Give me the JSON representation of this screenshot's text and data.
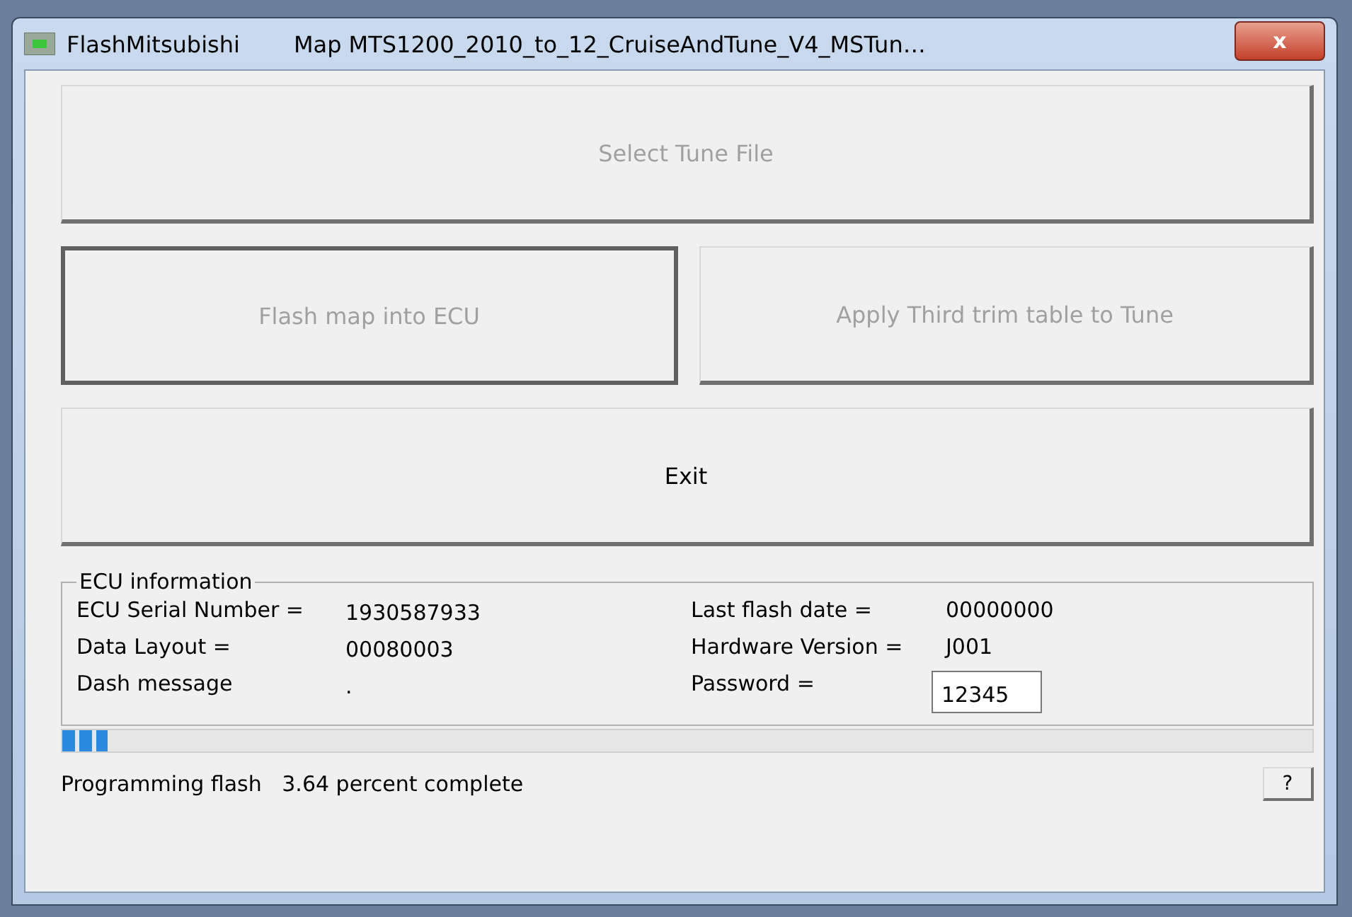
{
  "window": {
    "app_name": "FlashMitsubishi",
    "title": "Map MTS1200_2010_to_12_CruiseAndTune_V4_MSTun…",
    "close": "x"
  },
  "buttons": [
    {
      "label": "Select Tune File",
      "disabled": true,
      "focused": false
    },
    {
      "label": "Flash map into ECU",
      "disabled": true,
      "focused": true
    },
    {
      "label": "Apply Third trim table to Tune",
      "disabled": true,
      "focused": false
    },
    {
      "label": "Exit",
      "disabled": false,
      "focused": false
    }
  ],
  "ecu_information": {
    "legend": "ECU information",
    "rows": [
      {
        "label": "ECU Serial Number =",
        "value": "1930587933",
        "right_label": "Last flash date =",
        "right_value": "00000000",
        "kind": "text"
      },
      {
        "label": "Data Layout =",
        "value": "00080003",
        "right_label": "Hardware Version =",
        "right_value": "J001",
        "kind": "text"
      },
      {
        "label": "Dash message",
        "value": ".",
        "right_label": "Password =",
        "right_value": "12345",
        "kind": "field"
      }
    ]
  },
  "progress": {
    "level": 0.0364
  },
  "status_bar": {
    "text": "Programming flash   3.64 percent complete",
    "help_button": "?"
  }
}
